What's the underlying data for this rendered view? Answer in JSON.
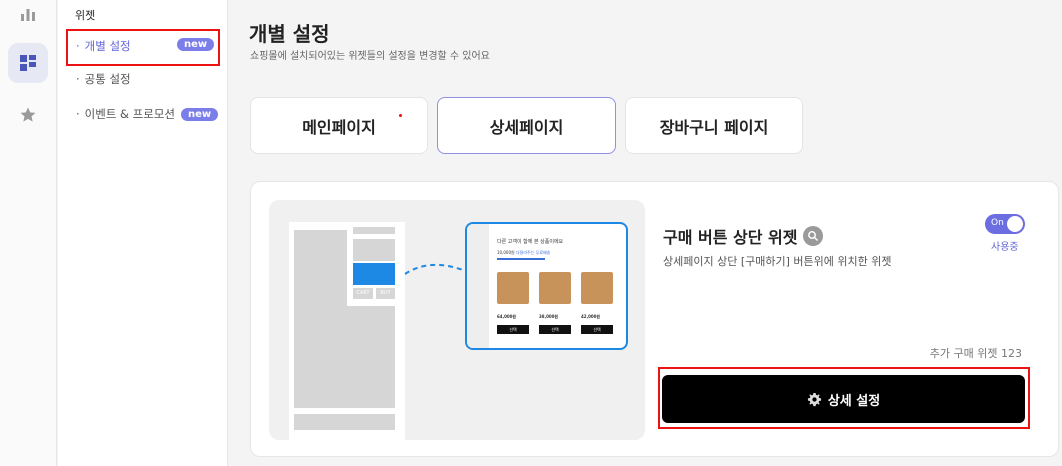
{
  "rail": {
    "items": [
      {
        "icon": "bar-chart-icon"
      },
      {
        "icon": "widget-grid-icon",
        "active": true
      },
      {
        "icon": "star-icon"
      }
    ]
  },
  "sidebar": {
    "title": "위젯",
    "items": [
      {
        "label": "개별 설정",
        "badge": "new",
        "active": true
      },
      {
        "label": "공통 설정"
      },
      {
        "label": "이벤트 & 프로모션",
        "badge": "new"
      }
    ],
    "bullet": "·"
  },
  "header": {
    "title": "개별 설정",
    "subtitle": "쇼핑몰에 설치되어있는 위젯들의 설정을 변경할 수 있어요"
  },
  "tabs": [
    {
      "label": "메인페이지",
      "has_dot": true
    },
    {
      "label": "상세페이지",
      "active": true
    },
    {
      "label": "장바구니 페이지"
    }
  ],
  "widget": {
    "title": "구매 버튼 상단 위젯",
    "description": "상세페이지 상단 [구매하기] 버튼위에 위치한 위젯",
    "toggle_label": "On",
    "toggle_status": "사용중",
    "extra": "추가 구매 위젯 123",
    "detail_button": "상세 설정",
    "preview": {
      "cart_label": "CART",
      "buy_label": "BUY",
      "popup_title": "다른 고객이 함께 본 상품이에요",
      "popup_price_note": "10,000원",
      "popup_note": "다잘라주는 무료배송",
      "prices": [
        "64,000원",
        "38,000원",
        "42,000원"
      ],
      "buy_button": "선택"
    }
  },
  "colors": {
    "accent": "#6b6de0",
    "highlight": "#ee1111",
    "preview_blue": "#1e88e5"
  }
}
